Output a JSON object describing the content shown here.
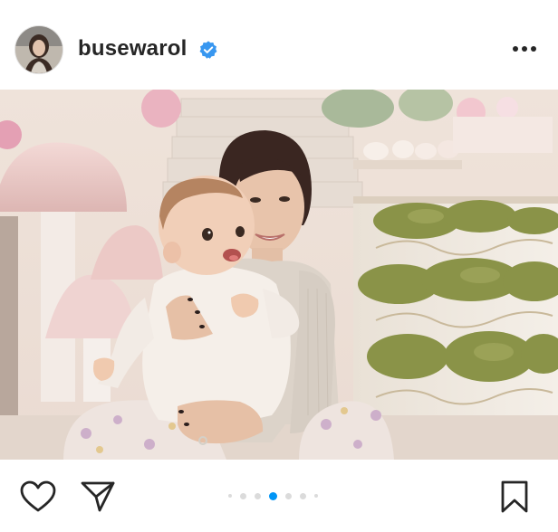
{
  "post": {
    "username": "busewarol",
    "verified": true,
    "carousel": {
      "total_dots": 7,
      "active_index": 3
    }
  },
  "icons": {
    "verified": "verified-badge-icon",
    "more": "more-options-icon",
    "like": "heart-icon",
    "share": "paper-plane-icon",
    "save": "bookmark-icon"
  },
  "colors": {
    "text": "#262626",
    "verified_blue": "#3897f0",
    "active_dot": "#0095f6",
    "inactive_dot": "#dbdbdb"
  }
}
